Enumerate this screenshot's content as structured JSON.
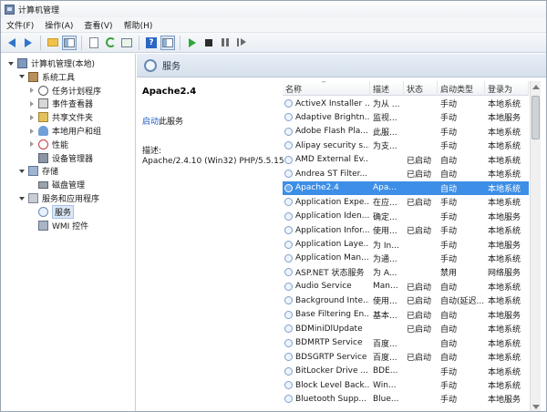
{
  "window": {
    "title": "计算机管理"
  },
  "menu": [
    "文件(F)",
    "操作(A)",
    "查看(V)",
    "帮助(H)"
  ],
  "toolbar_icons": [
    "back-arrow-icon",
    "forward-arrow-icon",
    "up-folder-icon",
    "show-hide-tree-icon",
    "properties-icon",
    "refresh-icon",
    "export-list-icon",
    "help-icon",
    "console-view-icon",
    "start-service-icon",
    "stop-service-icon",
    "pause-service-icon",
    "restart-service-icon"
  ],
  "tree": [
    {
      "label": "计算机管理(本地)",
      "level": 0,
      "expander": "open",
      "icon": "computer-icon"
    },
    {
      "label": "系统工具",
      "level": 1,
      "expander": "open",
      "icon": "tools-icon"
    },
    {
      "label": "任务计划程序",
      "level": 2,
      "expander": "closed",
      "icon": "clock-icon"
    },
    {
      "label": "事件查看器",
      "level": 2,
      "expander": "closed",
      "icon": "event-viewer-icon"
    },
    {
      "label": "共享文件夹",
      "level": 2,
      "expander": "closed",
      "icon": "shared-folder-icon"
    },
    {
      "label": "本地用户和组",
      "level": 2,
      "expander": "closed",
      "icon": "users-icon"
    },
    {
      "label": "性能",
      "level": 2,
      "expander": "closed",
      "icon": "performance-icon"
    },
    {
      "label": "设备管理器",
      "level": 2,
      "expander": "none",
      "icon": "device-manager-icon"
    },
    {
      "label": "存储",
      "level": 1,
      "expander": "open",
      "icon": "storage-icon"
    },
    {
      "label": "磁盘管理",
      "level": 2,
      "expander": "none",
      "icon": "disk-icon"
    },
    {
      "label": "服务和应用程序",
      "level": 1,
      "expander": "open",
      "icon": "apps-icon"
    },
    {
      "label": "服务",
      "level": 2,
      "expander": "none",
      "icon": "services-icon",
      "selected": true
    },
    {
      "label": "WMI 控件",
      "level": 2,
      "expander": "none",
      "icon": "wmi-icon"
    }
  ],
  "header": {
    "title": "服务"
  },
  "detail": {
    "service_name": "Apache2.4",
    "start_link": "启动",
    "start_suffix": "此服务",
    "desc_label": "描述:",
    "desc_text": "Apache/2.4.10 (Win32) PHP/5.5.15"
  },
  "columns": [
    "名称",
    "描述",
    "状态",
    "启动类型",
    "登录为"
  ],
  "rows": [
    {
      "name": "ActiveX Installer ...",
      "desc": "为从 ...",
      "status": "",
      "startup": "手动",
      "logon": "本地系统"
    },
    {
      "name": "Adaptive Brightn...",
      "desc": "监视...",
      "status": "",
      "startup": "手动",
      "logon": "本地服务"
    },
    {
      "name": "Adobe Flash Pla...",
      "desc": "此服...",
      "status": "",
      "startup": "手动",
      "logon": "本地系统"
    },
    {
      "name": "Alipay security s...",
      "desc": "为支...",
      "status": "",
      "startup": "手动",
      "logon": "本地系统"
    },
    {
      "name": "AMD External Ev...",
      "desc": "",
      "status": "已启动",
      "startup": "自动",
      "logon": "本地系统"
    },
    {
      "name": "Andrea ST Filter...",
      "desc": "",
      "status": "已启动",
      "startup": "自动",
      "logon": "本地系统"
    },
    {
      "name": "Apache2.4",
      "desc": "Apa...",
      "status": "",
      "startup": "自动",
      "logon": "本地系统",
      "selected": true
    },
    {
      "name": "Application Expe...",
      "desc": "在应...",
      "status": "已启动",
      "startup": "手动",
      "logon": "本地系统"
    },
    {
      "name": "Application Iden...",
      "desc": "确定...",
      "status": "",
      "startup": "手动",
      "logon": "本地服务"
    },
    {
      "name": "Application Infor...",
      "desc": "使用...",
      "status": "已启动",
      "startup": "手动",
      "logon": "本地系统"
    },
    {
      "name": "Application Laye...",
      "desc": "为 In...",
      "status": "",
      "startup": "手动",
      "logon": "本地服务"
    },
    {
      "name": "Application Man...",
      "desc": "为通...",
      "status": "",
      "startup": "手动",
      "logon": "本地系统"
    },
    {
      "name": "ASP.NET 状态服务",
      "desc": "为 A...",
      "status": "",
      "startup": "禁用",
      "logon": "网络服务"
    },
    {
      "name": "Audio Service",
      "desc": "Man...",
      "status": "已启动",
      "startup": "自动",
      "logon": "本地系统"
    },
    {
      "name": "Background Inte...",
      "desc": "使用...",
      "status": "已启动",
      "startup": "自动(延迟...",
      "logon": "本地系统"
    },
    {
      "name": "Base Filtering En...",
      "desc": "基本...",
      "status": "已启动",
      "startup": "自动",
      "logon": "本地服务"
    },
    {
      "name": "BDMiniDlUpdate",
      "desc": "",
      "status": "已启动",
      "startup": "自动",
      "logon": "本地系统"
    },
    {
      "name": "BDMRTP Service",
      "desc": "百度...",
      "status": "",
      "startup": "自动",
      "logon": "本地系统"
    },
    {
      "name": "BDSGRTP Service",
      "desc": "百度...",
      "status": "已启动",
      "startup": "自动",
      "logon": "本地系统"
    },
    {
      "name": "BitLocker Drive ...",
      "desc": "BDE...",
      "status": "",
      "startup": "手动",
      "logon": "本地系统"
    },
    {
      "name": "Block Level Back...",
      "desc": "Win...",
      "status": "",
      "startup": "手动",
      "logon": "本地系统"
    },
    {
      "name": "Bluetooth Supp...",
      "desc": "Blue...",
      "status": "",
      "startup": "手动",
      "logon": "本地服务"
    }
  ]
}
